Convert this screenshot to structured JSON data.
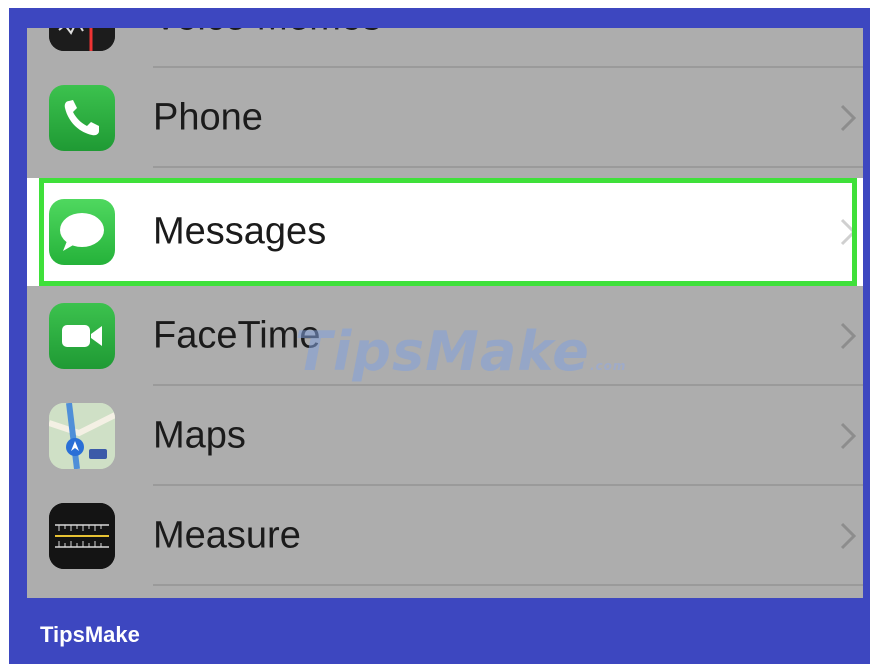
{
  "settings_list": {
    "items": [
      {
        "label": "Voice Memos",
        "icon": "voice-memos-icon"
      },
      {
        "label": "Phone",
        "icon": "phone-icon"
      },
      {
        "label": "Messages",
        "icon": "messages-icon"
      },
      {
        "label": "FaceTime",
        "icon": "facetime-icon"
      },
      {
        "label": "Maps",
        "icon": "maps-icon"
      },
      {
        "label": "Measure",
        "icon": "measure-icon"
      }
    ],
    "highlighted": "Messages"
  },
  "watermark": {
    "text": "TipsMake",
    "suffix": ".com"
  },
  "footer": {
    "brand": "TipsMake"
  },
  "colors": {
    "frame": "#3d47c0",
    "highlight_border": "#3fe03a",
    "list_background": "#adadad"
  }
}
